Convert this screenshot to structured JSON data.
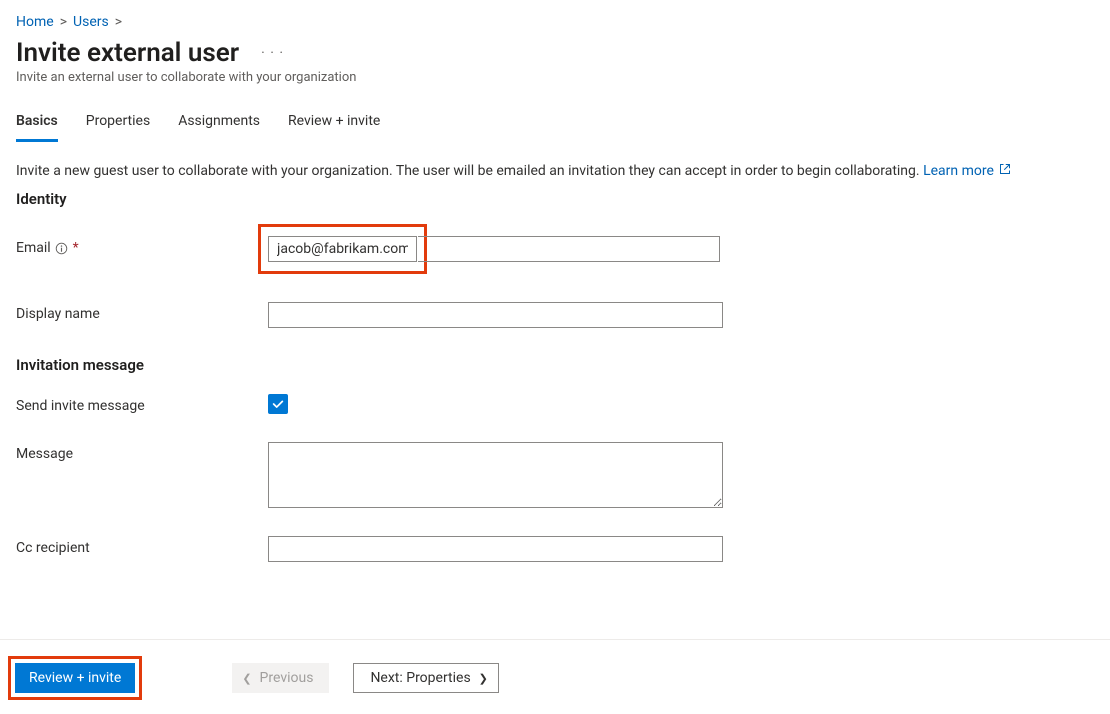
{
  "breadcrumb": {
    "home": "Home",
    "users": "Users"
  },
  "header": {
    "title": "Invite external user",
    "subtitle": "Invite an external user to collaborate with your organization"
  },
  "tabs": {
    "basics": "Basics",
    "properties": "Properties",
    "assignments": "Assignments",
    "review_invite": "Review + invite"
  },
  "intro": {
    "text": "Invite a new guest user to collaborate with your organization. The user will be emailed an invitation they can accept in order to begin collaborating. ",
    "learn_more": "Learn more"
  },
  "sections": {
    "identity": "Identity",
    "invitation_message": "Invitation message"
  },
  "fields": {
    "email_label": "Email",
    "email_value": "jacob@fabrikam.com",
    "display_name_label": "Display name",
    "display_name_value": "",
    "send_invite_label": "Send invite message",
    "send_invite_checked": true,
    "message_label": "Message",
    "message_value": "",
    "cc_label": "Cc recipient",
    "cc_value": ""
  },
  "footer": {
    "review_invite": "Review + invite",
    "previous": "Previous",
    "next": "Next: Properties"
  }
}
